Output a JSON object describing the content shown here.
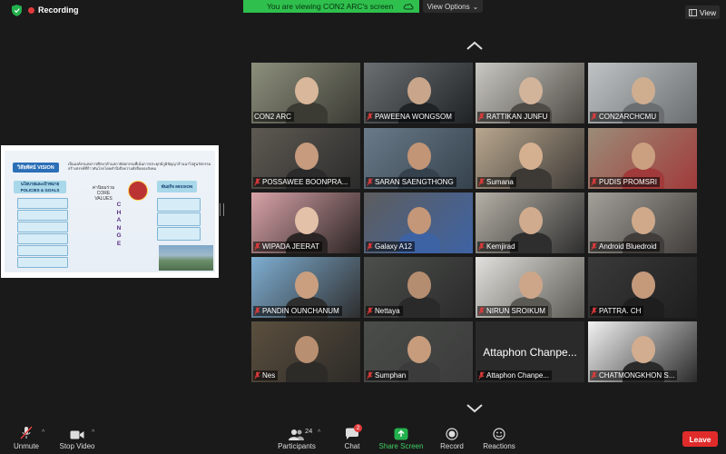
{
  "top": {
    "recording_label": "Recording",
    "viewing_banner": "You are viewing CON2 ARC's screen",
    "view_options_label": "View Options",
    "view_button_label": "View"
  },
  "shared_slide": {
    "vision_label": "วิสัยทัศน์ VISION",
    "vision_text": "เป็นองค์กรแห่งการศึกษาด้านสถาปัตยกรรมที่เน้นการประยุกต์ภูมิปัญญาล้านนาไปสู่นวัตกรรมสร้างสรรค์ที่ก้าวทันโลกโดยคำนึงถึงความยั่งยืนของสังคม",
    "policy_label": "นโยบายและเป้าหมาย POLICIES & GOALS",
    "core_values_label": "ค่านิยมร่วม CORE VALUES",
    "change_letters": [
      "C",
      "H",
      "A",
      "N",
      "G",
      "E"
    ],
    "mission_label": "พันธกิจ MISSION"
  },
  "participants": [
    {
      "name": "CON2 ARC",
      "muted": false,
      "active": true
    },
    {
      "name": "PAWEENA WONGSOM",
      "muted": true
    },
    {
      "name": "RATTIKAN JUNFU",
      "muted": true
    },
    {
      "name": "CON2ARCHCMU",
      "muted": true
    },
    {
      "name": "POSSAWEE BOONPRA...",
      "muted": true
    },
    {
      "name": "SARAN SAENGTHONG",
      "muted": true
    },
    {
      "name": "Sumana",
      "muted": true
    },
    {
      "name": "PUDIS PROMSRI",
      "muted": true
    },
    {
      "name": "WIPADA JEERAT",
      "muted": true
    },
    {
      "name": "Galaxy A12",
      "muted": true
    },
    {
      "name": "Kemjirad",
      "muted": true
    },
    {
      "name": "Android Bluedroid",
      "muted": true
    },
    {
      "name": "PANDIN OUNCHANUM",
      "muted": true
    },
    {
      "name": "Nettaya",
      "muted": true
    },
    {
      "name": "NIRUN SROIKUM",
      "muted": true
    },
    {
      "name": "PATTRA. CH",
      "muted": true
    },
    {
      "name": "Nes",
      "muted": true
    },
    {
      "name": "Sumphan",
      "muted": true
    },
    {
      "name": "Attaphon Chanpe...",
      "muted": true,
      "no_video": true
    },
    {
      "name": "CHATMONGKHON S...",
      "muted": true
    }
  ],
  "toolbar": {
    "unmute_label": "Unmute",
    "stop_video_label": "Stop Video",
    "participants_label": "Participants",
    "participants_count": "24",
    "chat_label": "Chat",
    "chat_badge": "2",
    "share_screen_label": "Share Screen",
    "record_label": "Record",
    "reactions_label": "Reactions",
    "leave_label": "Leave"
  },
  "colors": {
    "accent_green": "#2fbf4d",
    "leave_red": "#e02b2b",
    "active_border": "#c8e23b"
  }
}
